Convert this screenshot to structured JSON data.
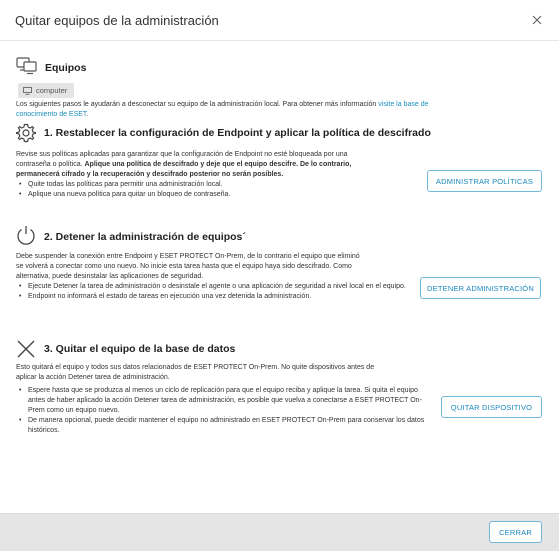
{
  "dialog": {
    "title": "Quitar equipos de la administración",
    "close_icon": "close-icon"
  },
  "devices": {
    "heading": "Equipos",
    "chip_label": "computer",
    "intro": "Los siguientes pasos le ayudarán a desconectar su equipo de la administración local. Para obtener más información ",
    "intro_link_1": "visite la base de",
    "intro_link_2": "conocimiento de ESET",
    "intro_end": "."
  },
  "step1": {
    "heading": "1. Restablecer la configuración de Endpoint y aplicar la política de descifrado",
    "para_line1": "Revise sus políticas aplicadas para garantizar que la configuración de Endpoint no esté bloqueada por una",
    "para_line2_normal": "contraseña o política. ",
    "para_line2_bold": "Aplique una política de descifrado y deje que el equipo descifre. De lo contrario,",
    "para_line3_bold": "permanecerá cifrado y la recuperación y descifrado posterior no serán posibles.",
    "bullets": [
      "Quite todas las políticas para permitir una administración local.",
      "Aplique una nueva política para quitar un bloqueo de contraseña."
    ],
    "button": "ADMINISTRAR POLÍTICAS"
  },
  "step2": {
    "heading": "2. Detener la administración de equipos´",
    "para_lines": [
      "Debe suspender la conexión entre Endpoint y ESET PROTECT On-Prem, de lo contrario el equipo que eliminó",
      "se volverá a conectar como uno nuevo. No inicie esta tarea hasta que el equipo haya sido descifrado. Como",
      "alternativa, puede desinstalar las aplicaciones de seguridad."
    ],
    "bullets": [
      "Ejecute Detener la tarea de administración o desinstale el agente o una aplicación de seguridad a nivel local en el equipo.",
      "Endpoint no informará el estado de tareas en ejecución una vez detenida la administración."
    ],
    "button": "DETENER ADMINISTRACIÓN"
  },
  "step3": {
    "heading": "3. Quitar el equipo de la base de datos",
    "para_lines": [
      "Esto quitará el equipo y todos sus datos relacionados de ESET PROTECT On-Prem. No quite dispositivos antes de",
      "aplicar la acción Detener tarea de administración."
    ],
    "bullets": [
      "Espere hasta que se produzca al menos un ciclo de replicación para que el equipo reciba y aplique la tarea. Si quita el equipo antes de haber aplicado la acción Detener tarea de administración, es posible que vuelva a conectarse a ESET PROTECT On-Prem como un equipo nuevo.",
      "De manera opcional, puede decidir mantener el equipo no administrado en ESET PROTECT On-Prem para conservar los datos históricos."
    ],
    "button": "QUITAR DISPOSITIVO"
  },
  "footer": {
    "close_button": "CERRAR"
  }
}
